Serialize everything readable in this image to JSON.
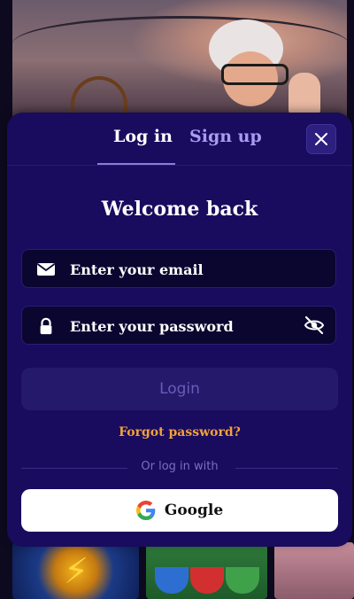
{
  "tabs": [
    {
      "label": "Log in",
      "active": true
    },
    {
      "label": "Sign up",
      "active": false
    }
  ],
  "modal": {
    "title": "Welcome back",
    "email": {
      "placeholder": "Enter your email",
      "icon": "mail-icon"
    },
    "password": {
      "placeholder": "Enter your password",
      "icon": "lock-icon",
      "toggle_icon": "eye-off-icon"
    },
    "login_label": "Login",
    "forgot_label": "Forgot password?",
    "divider_text": "Or log in with",
    "google_label": "Google",
    "close_icon": "close-icon"
  },
  "colors": {
    "modal_bg": "#190b5e",
    "accent_forgot": "#f2a13a",
    "tab_inactive": "#a99bf0",
    "login_disabled_text": "#6a5bb8"
  }
}
